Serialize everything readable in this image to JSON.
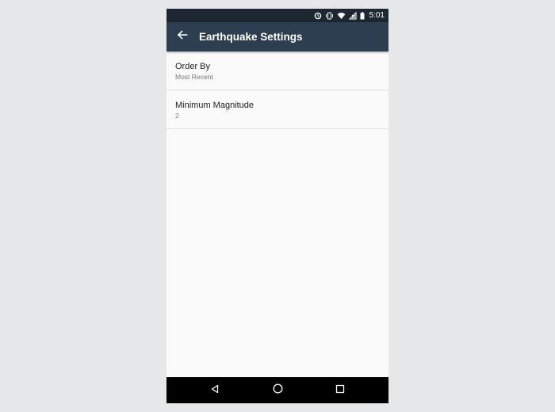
{
  "status_bar": {
    "time": "5:01",
    "icons": [
      "sync-icon",
      "vibrate-icon",
      "wifi-icon",
      "no-signal-icon",
      "battery-icon"
    ]
  },
  "app_bar": {
    "title": "Earthquake Settings",
    "back_icon": "back-arrow-icon",
    "background": "#2c3e50"
  },
  "preferences": [
    {
      "title": "Order By",
      "summary": "Most Recent"
    },
    {
      "title": "Minimum Magnitude",
      "summary": "2"
    }
  ],
  "nav_bar": {
    "buttons": [
      "back-triangle-icon",
      "home-circle-icon",
      "recents-square-icon"
    ]
  },
  "colors": {
    "status_bar": "#1d2731",
    "app_bar": "#2c3e50",
    "background": "#fafafa",
    "divider": "#e0e0e0"
  }
}
